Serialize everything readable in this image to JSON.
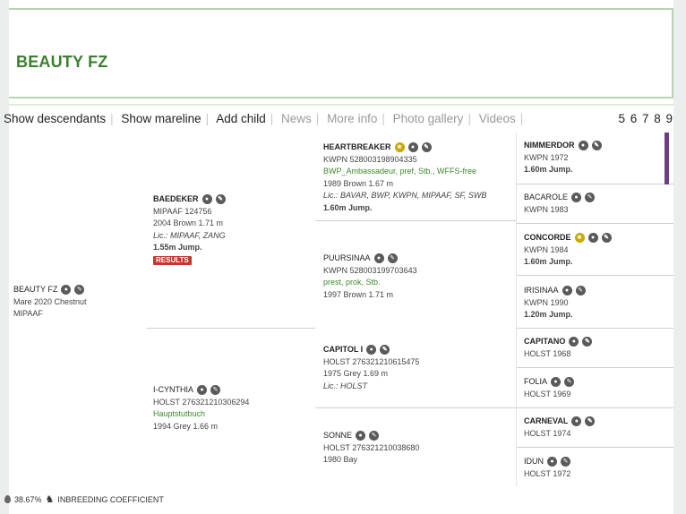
{
  "title": "BEAUTY FZ",
  "nav": {
    "links": [
      {
        "label": "Show descendants",
        "dim": false
      },
      {
        "label": "Show mareline",
        "dim": false
      },
      {
        "label": "Add child",
        "dim": false
      },
      {
        "label": "News",
        "dim": true
      },
      {
        "label": "More info",
        "dim": true
      },
      {
        "label": "Photo gallery",
        "dim": true
      },
      {
        "label": "Videos",
        "dim": true
      }
    ],
    "pages": "5 6 7 8 9"
  },
  "subject": {
    "name": "BEAUTY FZ",
    "line1": "Mare 2020 Chestnut",
    "line2": "MIPAAF"
  },
  "sire": {
    "name": "BAEDEKER",
    "reg": "MIPAAF 124756",
    "info": "2004 Brown 1.71 m",
    "lic": "Lic.: MIPAAF, ZANG",
    "jump": "1.55m Jump.",
    "badge": "RESULTS"
  },
  "dam": {
    "name": "I-CYNTHIA",
    "reg": "HOLST 276321210306294",
    "pred": "Hauptstutbuch",
    "info": "1994 Grey 1.66 m"
  },
  "ss": {
    "name": "HEARTBREAKER",
    "reg": "KWPN 528003198904335",
    "pred": "BWP_Ambassadeur, pref, Stb., WFFS-free",
    "info": "1989 Brown 1.67 m",
    "lic": "Lic.: BAVAR, BWP, KWPN, MIPAAF, SF, SWB",
    "jump": "1.60m Jump."
  },
  "sd": {
    "name": "PUURSINAA",
    "reg": "KWPN 528003199703643",
    "pred": "prest, prok, Stb.",
    "info": "1997 Brown 1.71 m"
  },
  "ds": {
    "name": "CAPITOL I",
    "reg": "HOLST 276321210615475",
    "info": "1975 Grey 1.69 m",
    "lic": "Lic.: HOLST"
  },
  "dd": {
    "name": "SONNE",
    "reg": "HOLST 276321210038680",
    "info": "1980 Bay"
  },
  "g3": [
    {
      "name": "NIMMERDOR",
      "reg": "KWPN 1972",
      "jump": "1.60m Jump."
    },
    {
      "name": "BACAROLE",
      "reg": "KWPN 1983"
    },
    {
      "name": "CONCORDE",
      "reg": "KWPN 1984",
      "jump": "1.60m Jump."
    },
    {
      "name": "IRISINAA",
      "reg": "KWPN 1990",
      "jump": "1.20m Jump."
    },
    {
      "name": "CAPITANO",
      "reg": "HOLST 1968"
    },
    {
      "name": "FOLIA",
      "reg": "HOLST 1969"
    },
    {
      "name": "CARNEVAL",
      "reg": "HOLST 1974"
    },
    {
      "name": "IDUN",
      "reg": "HOLST 1972"
    }
  ],
  "inbreeding": {
    "value": "38.67%",
    "label": "INBREEDING COEFFICIENT"
  },
  "colors": {
    "accent": "#3d7f2e",
    "results": "#c0392b",
    "purple_marker": "#6b3f86",
    "gold_icon": "#c7a800"
  },
  "icons": [
    "group-icon",
    "edit-icon",
    "award-icon",
    "water-drop-icon",
    "horse-icon"
  ]
}
